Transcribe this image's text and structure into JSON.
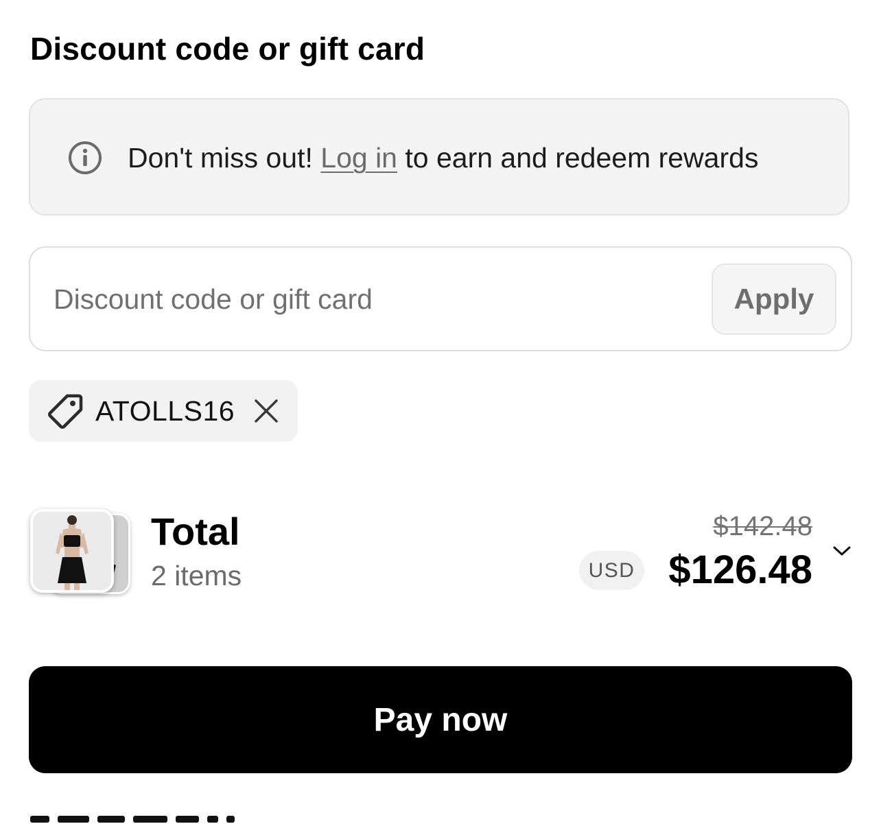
{
  "discount_section": {
    "heading": "Discount code or gift card",
    "notice": {
      "icon": "info-icon",
      "text_before": "Don't miss out! ",
      "link_text": "Log in",
      "text_after": " to earn and redeem rewards"
    },
    "input": {
      "placeholder": "Discount code or gift card",
      "value": ""
    },
    "apply_label": "Apply",
    "applied_code": {
      "icon": "tag-icon",
      "code": "ATOLLS16",
      "remove_icon": "close-icon"
    }
  },
  "summary": {
    "thumbnail": "product-thumbnail-stack",
    "total_label": "Total",
    "items_count": "2 items",
    "original_price": "$142.48",
    "currency": "USD",
    "final_price": "$126.48",
    "expand_icon": "chevron-down-icon"
  },
  "pay_button_label": "Pay now"
}
